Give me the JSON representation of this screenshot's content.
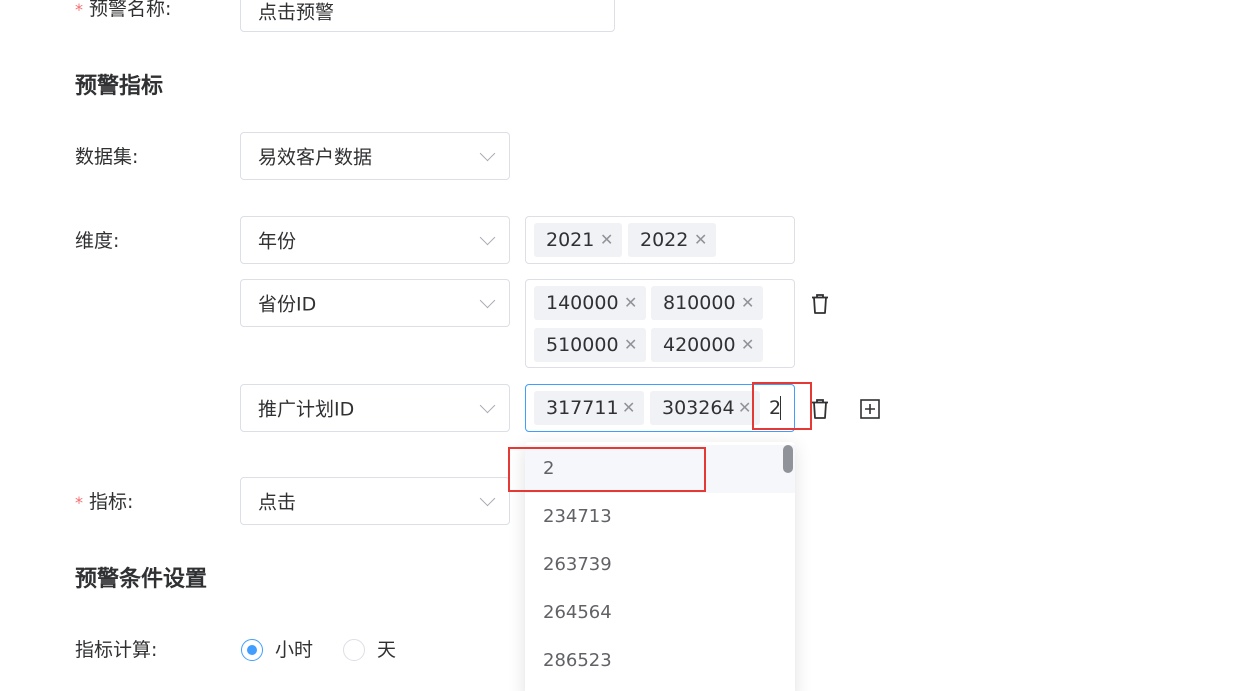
{
  "alert_name": {
    "label": "预警名称:",
    "value": "点击预警"
  },
  "section_indicator": {
    "title": "预警指标"
  },
  "dataset": {
    "label": "数据集:",
    "value": "易效客户数据"
  },
  "dimension": {
    "label": "维度:",
    "rows": [
      {
        "field": "年份",
        "tags": [
          "2021",
          "2022"
        ]
      },
      {
        "field": "省份ID",
        "tags": [
          "140000",
          "810000",
          "510000",
          "420000"
        ]
      },
      {
        "field": "推广计划ID",
        "tags": [
          "317711",
          "303264"
        ],
        "typing": "2"
      }
    ]
  },
  "metric": {
    "label": "指标:",
    "value": "点击"
  },
  "dropdown": {
    "options": [
      "2",
      "234713",
      "263739",
      "264564",
      "286523"
    ]
  },
  "section_condition": {
    "title": "预警条件设置"
  },
  "metric_calc": {
    "label": "指标计算:",
    "options": [
      "小时",
      "天"
    ],
    "selected": "小时"
  },
  "colors": {
    "accent": "#409eff",
    "required": "#f56c6c",
    "highlight": "#e53935"
  },
  "icons": [
    "chevron-down-icon",
    "close-icon",
    "trash-icon",
    "plus-square-icon"
  ]
}
